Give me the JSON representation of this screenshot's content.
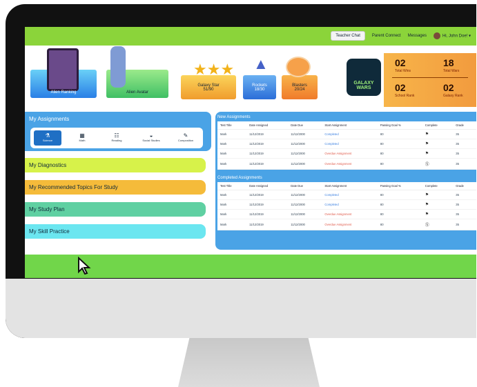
{
  "topbar": {
    "chat": "Teacher Chat",
    "parent": "Parent Connect",
    "messages": "Messages",
    "user": "Hi, John Doe! ▾"
  },
  "hero": {
    "alien_ranking": "Alien Ranking",
    "alien_avatar": "Alien Avatar",
    "galaxy_star": {
      "label": "Galaxy Star",
      "value": "51/90"
    },
    "rockets": {
      "label": "Rockets",
      "value": "18/30"
    },
    "blasters": {
      "label": "Blasters",
      "value": "20/24"
    },
    "logo": "GALAXY WARS",
    "stats": [
      {
        "n": "02",
        "l": "Total Wins"
      },
      {
        "n": "18",
        "l": "Total Wars"
      },
      {
        "n": "02",
        "l": "School Rank"
      },
      {
        "n": "02",
        "l": "Galaxy Rank"
      }
    ]
  },
  "left": {
    "assign": "My Assignments",
    "subjects": [
      {
        "label": "Science",
        "icon": "⚗"
      },
      {
        "label": "Math",
        "icon": "▦"
      },
      {
        "label": "Reading",
        "icon": "☷"
      },
      {
        "label": "Social Studies",
        "icon": "◒"
      },
      {
        "label": "Composition",
        "icon": "✎"
      }
    ],
    "items": [
      {
        "label": "My Diagnostics",
        "color": "#d7f24a"
      },
      {
        "label": "My Recommended Topics For Study",
        "color": "#f5bb3a"
      },
      {
        "label": "My Study Plan",
        "color": "#5fd0a2"
      },
      {
        "label": "My Skill Practice",
        "color": "#6be6f0"
      }
    ]
  },
  "right": {
    "new_title": "New Assignments",
    "completed_title": "Completed Assignments",
    "headers": [
      "Test Title",
      "Date Assigned",
      "Date Due",
      "Start Assignment",
      "Passing Goal %",
      "Complete",
      "Grade"
    ],
    "new_rows": [
      [
        "Mark",
        "11/12/2019",
        "11/12/2000",
        "Completed",
        "80",
        "⚑",
        "35"
      ],
      [
        "Mark",
        "11/12/2019",
        "11/12/2000",
        "Completed",
        "80",
        "⚑",
        "35"
      ],
      [
        "Mark",
        "11/12/2019",
        "11/12/2000",
        "Overdue Assignment",
        "80",
        "⚑",
        "35"
      ],
      [
        "Mark",
        "11/12/2019",
        "11/12/2000",
        "Overdue Assignment",
        "80",
        "Ⓢ",
        "35"
      ]
    ],
    "completed_rows": [
      [
        "Mark",
        "11/12/2019",
        "11/12/2000",
        "Completed",
        "80",
        "⚑",
        "35"
      ],
      [
        "Mark",
        "11/12/2019",
        "11/12/2000",
        "Completed",
        "80",
        "⚑",
        "35"
      ],
      [
        "Mark",
        "11/12/2019",
        "11/12/2000",
        "Overdue Assignment",
        "80",
        "⚑",
        "35"
      ],
      [
        "Mark",
        "11/12/2019",
        "11/12/2000",
        "Overdue Assignment",
        "80",
        "Ⓢ",
        "35"
      ]
    ]
  }
}
